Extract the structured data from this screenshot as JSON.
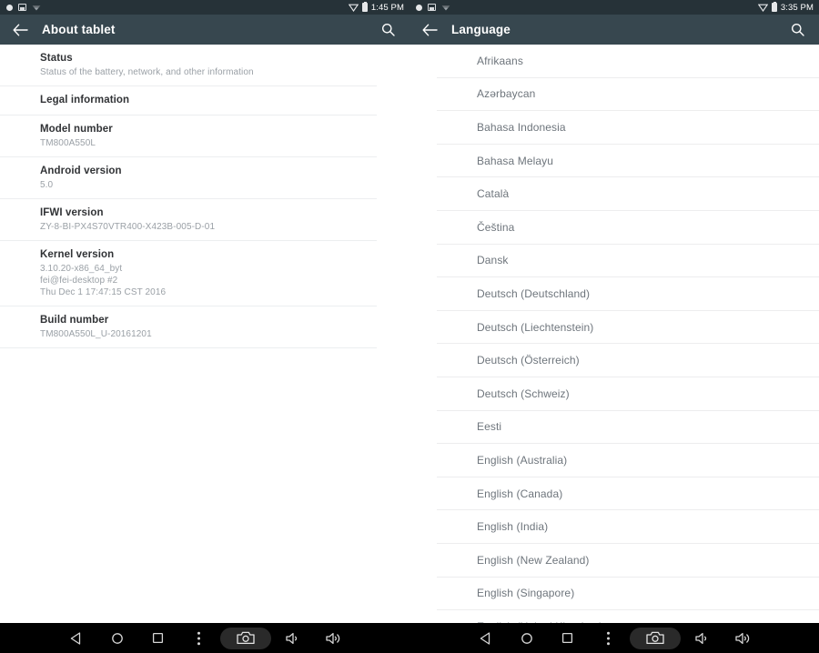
{
  "left_panel": {
    "statusbar": {
      "icons_left": [
        "record-dot-icon",
        "screenshot-icon",
        "wifi-weak-icon"
      ],
      "icons_right": [
        "signal-triangle-icon",
        "battery-icon"
      ],
      "time": "1:45 PM"
    },
    "appbar": {
      "back_icon": "back-arrow-icon",
      "title": "About tablet",
      "search_icon": "search-icon"
    },
    "rows": [
      {
        "title": "Status",
        "sub": "Status of the battery, network, and other information"
      },
      {
        "title": "Legal information",
        "sub": ""
      },
      {
        "title": "Model number",
        "sub": "TM800A550L"
      },
      {
        "title": "Android version",
        "sub": "5.0"
      },
      {
        "title": "IFWI version",
        "sub": "ZY-8-BI-PX4S70VTR400-X423B-005-D-01"
      },
      {
        "title": "Kernel version",
        "sub": "3.10.20-x86_64_byt\nfei@fei-desktop #2\nThu Dec 1 17:47:15 CST 2016"
      },
      {
        "title": "Build number",
        "sub": "TM800A550L_U-20161201"
      }
    ]
  },
  "right_panel": {
    "statusbar": {
      "icons_left": [
        "record-dot-icon",
        "screenshot-icon",
        "wifi-weak-icon"
      ],
      "icons_right": [
        "signal-triangle-icon",
        "battery-icon"
      ],
      "time": "3:35 PM"
    },
    "appbar": {
      "back_icon": "back-arrow-icon",
      "title": "Language",
      "search_icon": "search-icon"
    },
    "languages": [
      "Afrikaans",
      "Azərbaycan",
      "Bahasa Indonesia",
      "Bahasa Melayu",
      "Català",
      "Čeština",
      "Dansk",
      "Deutsch (Deutschland)",
      "Deutsch (Liechtenstein)",
      "Deutsch (Österreich)",
      "Deutsch (Schweiz)",
      "Eesti",
      "English (Australia)",
      "English (Canada)",
      "English (India)",
      "English (New Zealand)",
      "English (Singapore)",
      "English (United Kingdom)"
    ]
  },
  "navbar": {
    "buttons": [
      {
        "name": "back-triangle-icon",
        "label": "Back"
      },
      {
        "name": "home-circle-icon",
        "label": "Home"
      },
      {
        "name": "recents-square-icon",
        "label": "Recents"
      },
      {
        "name": "overflow-menu-icon",
        "label": "Menu"
      },
      {
        "name": "screenshot-camera-icon",
        "label": "Screenshot"
      },
      {
        "name": "volume-down-icon",
        "label": "Volume down"
      },
      {
        "name": "volume-up-icon",
        "label": "Volume up"
      }
    ]
  },
  "colors": {
    "statusbar_bg": "#263238",
    "appbar_bg": "#37474f",
    "navbar_bg": "#000000",
    "page_bg": "#ffffff",
    "primary_text": "#313336",
    "secondary_text": "#9aa0a6",
    "list_text": "#6e757c",
    "divider": "#ededee"
  }
}
